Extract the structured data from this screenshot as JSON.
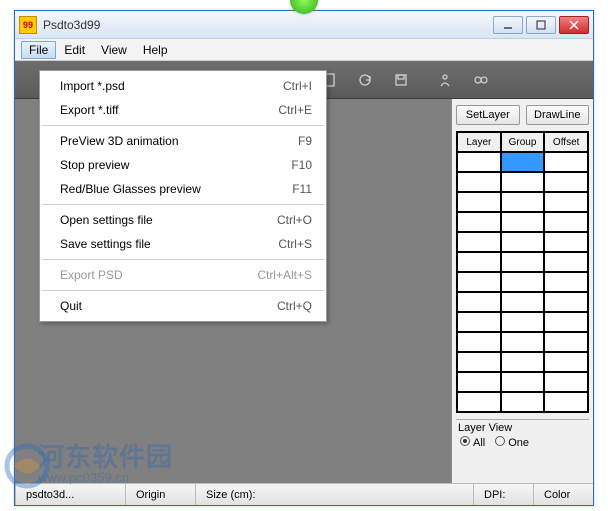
{
  "title": "Psdto3d99",
  "menubar": {
    "file": "File",
    "edit": "Edit",
    "view": "View",
    "help": "Help"
  },
  "filemenu": {
    "import_label": "Import *.psd",
    "import_sc": "Ctrl+I",
    "export_label": "Export *.tiff",
    "export_sc": "Ctrl+E",
    "preview3d_label": "PreView 3D animation",
    "preview3d_sc": "F9",
    "stop_label": "Stop preview",
    "stop_sc": "F10",
    "redblue_label": "Red/Blue Glasses preview",
    "redblue_sc": "F11",
    "opensettings_label": "Open settings file",
    "opensettings_sc": "Ctrl+O",
    "savesettings_label": "Save settings file",
    "savesettings_sc": "Ctrl+S",
    "exportpsd_label": "Export PSD",
    "exportpsd_sc": "Ctrl+Alt+S",
    "quit_label": "Quit",
    "quit_sc": "Ctrl+Q"
  },
  "rightpanel": {
    "tab_setlayer": "SetLayer",
    "tab_drawline": "DrawLine",
    "col_layer": "Layer",
    "col_group": "Group",
    "col_offset": "Offset",
    "layerview_title": "Layer View",
    "radio_all": "All",
    "radio_one": "One"
  },
  "status": {
    "file_label": "psdto3d...",
    "origin": "Origin",
    "size": "Size (cm):",
    "dpi": "DPI:",
    "color": "Color"
  },
  "watermark": {
    "text": "河东软件园",
    "url": "www.pc0359.cn"
  }
}
